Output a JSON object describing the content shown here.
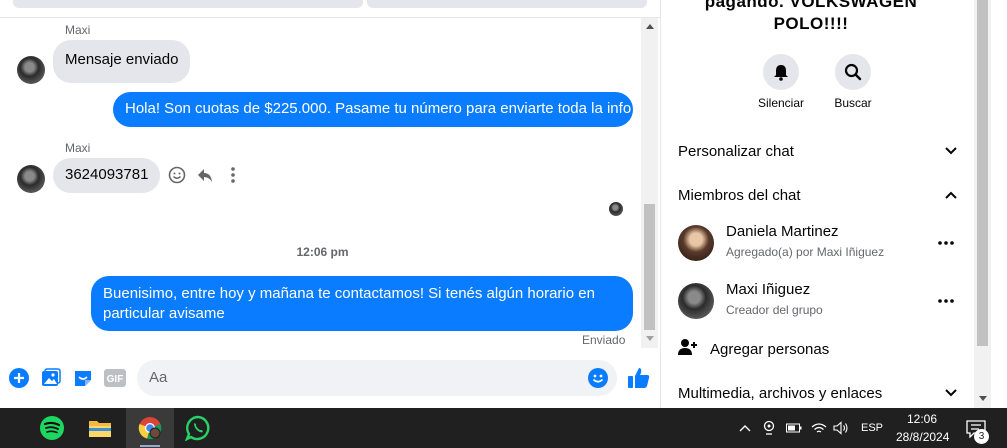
{
  "chat": {
    "messages": [
      {
        "sender": "Maxi",
        "text": "Mensaje enviado",
        "direction": "in"
      },
      {
        "text": "Hola! Son cuotas de $225.000. Pasame tu número para enviarte toda la info",
        "direction": "out"
      },
      {
        "sender": "Maxi",
        "text": "3624093781",
        "direction": "in"
      },
      {
        "time_separator": "12:06 pm"
      },
      {
        "text": "Buenisimo, entre hoy y mañana te contactamos! Si tenés algún horario en particular avisame",
        "direction": "out",
        "status": "Enviado"
      }
    ],
    "composer_placeholder": "Aa"
  },
  "info": {
    "group_title": "pagando. VOLKSWAGEN POLO!!!!",
    "actions": [
      {
        "label": "Silenciar",
        "icon": "bell-icon"
      },
      {
        "label": "Buscar",
        "icon": "search-icon"
      }
    ],
    "sections": {
      "personalize": "Personalizar chat",
      "members": "Miembros del chat",
      "media": "Multimedia, archivos y enlaces"
    },
    "members": [
      {
        "name": "Daniela Martinez",
        "subtitle": "Agregado(a) por Maxi Iñiguez"
      },
      {
        "name": "Maxi Iñiguez",
        "subtitle": "Creador del grupo"
      }
    ],
    "add_people": "Agregar personas"
  },
  "taskbar": {
    "apps": [
      "spotify-icon",
      "file-explorer-icon",
      "chrome-icon",
      "whatsapp-icon"
    ],
    "language": "ESP",
    "time": "12:06",
    "date": "28/8/2024",
    "notification_count": "3"
  },
  "colors": {
    "accent": "#0a7cff",
    "bubble_in": "#e4e6eb",
    "taskbar": "#202020"
  }
}
